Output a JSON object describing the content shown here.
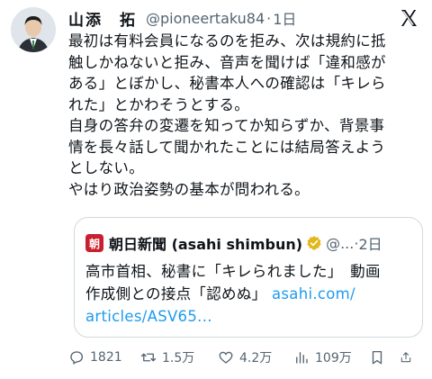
{
  "post": {
    "author_name": "山添　拓",
    "handle": "@pioneertaku84",
    "separator": "·",
    "time": "1日",
    "lines": [
      "最初は有料会員になるのを拒み、次は規約に抵",
      "触しかねないと拒み、音声を聞けば「違和感が",
      "ある」とぼかし、秘書本人への確認は「キレら",
      "れた」とかわそうとする。",
      "自身の答弁の変遷を知ってか知らずか、背景事",
      "情を長々話して聞かれたことには結局答えよう",
      "としない。",
      "やはり政治姿勢の基本が問われる。"
    ]
  },
  "quote": {
    "logo_text": "朝",
    "author_name": "朝日新聞 (asahi shimbun)",
    "handle": "@...",
    "separator": "·",
    "time": "2日",
    "line1": "高市首相、秘書に「キレられました」　動画",
    "line2_text": "作成側との接点「認めぬ」",
    "line2_link": "asahi.com/",
    "line3_link": "articles/ASV65..."
  },
  "actions": {
    "replies": "1821",
    "reposts": "1.5万",
    "likes": "4.2万",
    "views": "109万"
  },
  "colors": {
    "text": "#0f1419",
    "muted": "#536471",
    "link": "#1d9bf0",
    "border": "#cfd9de",
    "asahi_red": "#c8202f",
    "verified_gold": "#e2b719"
  },
  "icons": [
    "avatar",
    "x-logo-icon",
    "asahi-logo",
    "verified-badge-icon",
    "reply-icon",
    "repost-icon",
    "like-icon",
    "views-icon",
    "bookmark-icon",
    "share-icon"
  ]
}
